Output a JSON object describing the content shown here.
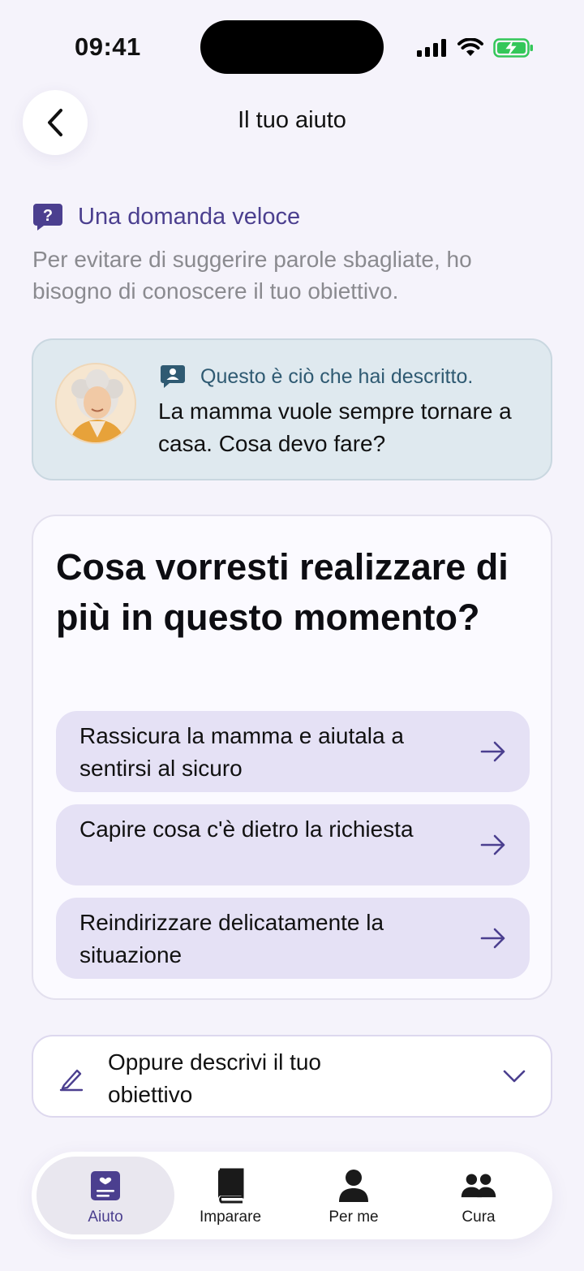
{
  "status_bar": {
    "time": "09:41",
    "battery_color": "#34c759"
  },
  "header": {
    "title": "Il tuo aiuto"
  },
  "question": {
    "title": "Una domanda veloce",
    "subtitle": "Per evitare di suggerire parole sbagliate, ho bisogno di conoscere il tuo obiettivo."
  },
  "described": {
    "label": "Questo è ciò che hai descritto.",
    "text": "La mamma vuole sempre tornare a casa. Cosa devo fare?"
  },
  "goal": {
    "question": "Cosa vorresti realizzare di più in questo momento?",
    "options": [
      {
        "label": "Rassicura la mamma e aiutala a sentirsi al sicuro"
      },
      {
        "label": "Capire cosa c'è dietro la richiesta"
      },
      {
        "label": "Reindirizzare delicatamente la situazione"
      }
    ]
  },
  "describe_own": {
    "label": "Oppure descrivi il tuo obiettivo"
  },
  "tabs": [
    {
      "label": "Aiuto",
      "icon": "help-card-icon",
      "active": true
    },
    {
      "label": "Imparare",
      "icon": "book-icon",
      "active": false
    },
    {
      "label": "Per me",
      "icon": "person-icon",
      "active": false
    },
    {
      "label": "Cura",
      "icon": "people-icon",
      "active": false
    }
  ],
  "colors": {
    "accent": "#4b3f8f",
    "option_bg": "#e5e1f5",
    "described_bg": "#dfe9ef",
    "background": "#f5f3fb"
  }
}
